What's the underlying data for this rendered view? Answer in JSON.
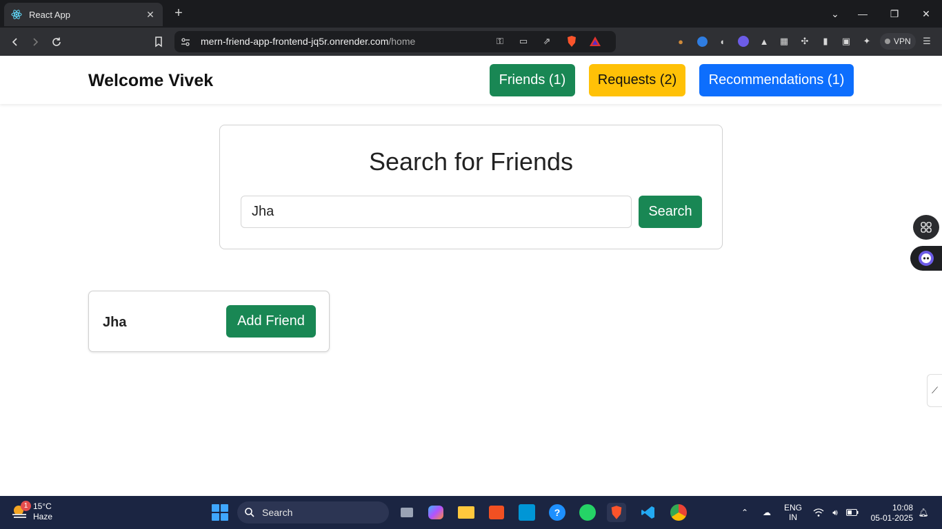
{
  "browser": {
    "tab_title": "React App",
    "url_host": "mern-friend-app-frontend-jq5r.onrender.com",
    "url_path": "/home",
    "vpn_label": "VPN"
  },
  "navbar": {
    "welcome": "Welcome Vivek",
    "friends_btn": "Friends (1)",
    "requests_btn": "Requests (2)",
    "recommendations_btn": "Recommendations (1)"
  },
  "search": {
    "title": "Search for Friends",
    "input_value": "Jha",
    "button_label": "Search"
  },
  "results": [
    {
      "name": "Jha",
      "action": "Add Friend"
    }
  ],
  "taskbar": {
    "weather_temp": "15°C",
    "weather_desc": "Haze",
    "weather_badge": "1",
    "search_placeholder": "Search",
    "lang_top": "ENG",
    "lang_bottom": "IN",
    "time": "10:08",
    "date": "05-01-2025"
  },
  "colors": {
    "success": "#198754",
    "warning": "#ffc107",
    "primary": "#0d6efd",
    "taskbar": "#1b2542"
  }
}
